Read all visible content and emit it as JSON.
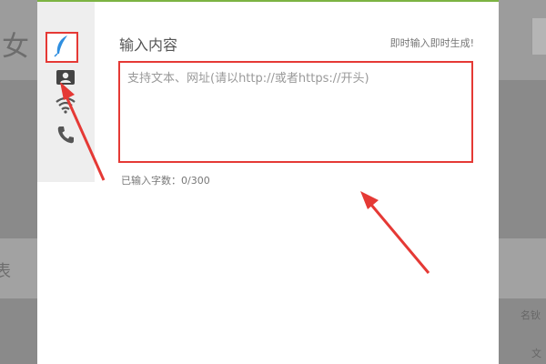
{
  "background": {
    "left_glyph": "女",
    "left_glyph_2": "表",
    "right_text_1": "名钬",
    "right_text_2": "文"
  },
  "modal": {
    "title": "输入内容",
    "hint": "即时输入即时生成!",
    "textarea": {
      "value": "",
      "placeholder": "支持文本、网址(请以http://或者https://开头)"
    },
    "counter": "已输入字数：0/300"
  },
  "sidebar": {
    "items": [
      {
        "icon": "feather-icon",
        "active": true
      },
      {
        "icon": "contact-card-icon",
        "active": false
      },
      {
        "icon": "wifi-icon",
        "active": false
      },
      {
        "icon": "phone-icon",
        "active": false
      }
    ]
  },
  "colors": {
    "accent_green": "#7cb342",
    "highlight_red": "#e53935",
    "feather_blue": "#2f8fe0"
  }
}
